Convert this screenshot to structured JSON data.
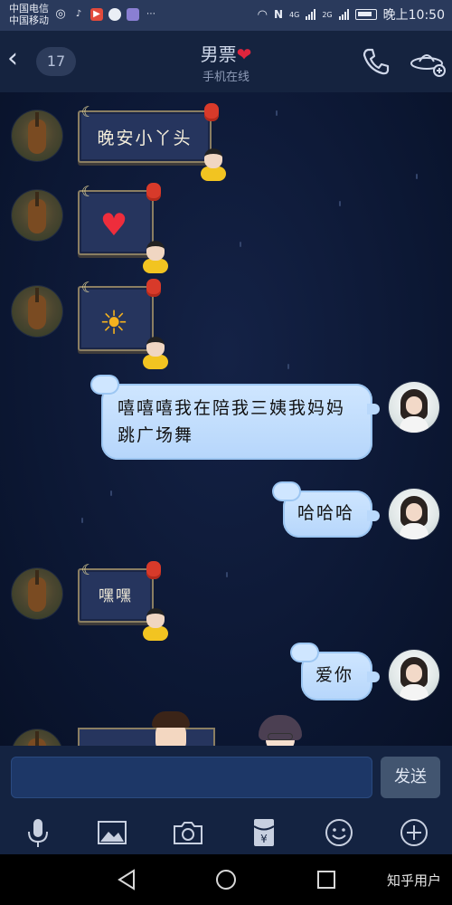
{
  "status_bar": {
    "carrier_1": "中国电信",
    "carrier_2": "中国移动",
    "network_1": "4G",
    "network_2": "2G",
    "time": "晚上10:50",
    "icons": [
      "hotspot-icon",
      "tiktok-icon",
      "video-icon",
      "chat-icon",
      "app-icon",
      "more-dots-icon",
      "headphones-icon",
      "nfc-icon",
      "signal-icon",
      "battery-icon"
    ]
  },
  "header": {
    "back_icon": "back-arrow-icon",
    "unread_count": "17",
    "contact_name": "男票",
    "name_emoji": "❤",
    "online_status": "手机在线",
    "call_icon": "phone-icon",
    "more_icon": "ufo-plus-icon"
  },
  "messages": [
    {
      "side": "left",
      "type": "text-sticker",
      "text": "晚安小丫头"
    },
    {
      "side": "left",
      "type": "emoji",
      "emoji": "heart"
    },
    {
      "side": "left",
      "type": "emoji",
      "emoji": "sun"
    },
    {
      "side": "right",
      "type": "text",
      "text": "嘻嘻嘻我在陪我三姨我妈妈跳广场舞"
    },
    {
      "side": "right",
      "type": "text",
      "text": "哈哈哈"
    },
    {
      "side": "left",
      "type": "text-sticker",
      "text": "嘿嘿"
    },
    {
      "side": "right",
      "type": "text",
      "text": "爱你"
    }
  ],
  "msg_line_1": "嘻嘻嘻我在陪我三姨我妈妈",
  "msg_line_2": "跳广场舞",
  "input": {
    "value": "",
    "send_label": "发送"
  },
  "toolbar": [
    "microphone-icon",
    "image-icon",
    "camera-icon",
    "red-packet-icon",
    "emoji-icon",
    "plus-icon"
  ],
  "red_packet_glyph": "¥",
  "system_nav": [
    "back-triangle-icon",
    "home-circle-icon",
    "recents-square-icon"
  ],
  "watermark": "知乎用户",
  "colors": {
    "chat_background": "#0b1631",
    "right_bubble": "#c4defd",
    "heart": "#e0253d"
  }
}
